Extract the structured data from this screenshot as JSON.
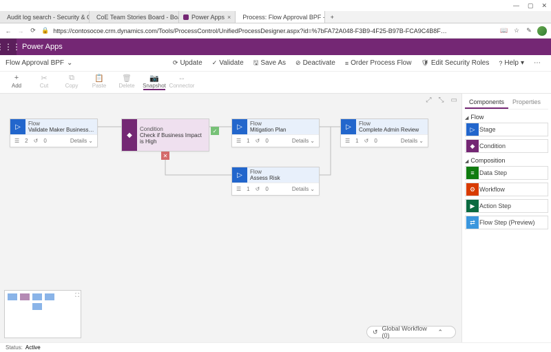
{
  "browser": {
    "win_controls": {
      "min": "—",
      "max": "▢",
      "close": "✕"
    },
    "tabs": [
      {
        "fav": "#4aa0e6",
        "label": "Audit log search - Security & C",
        "active": false
      },
      {
        "fav": "#2b6cb0",
        "label": "CoE Team Stories Board - Boards",
        "active": false
      },
      {
        "fav": "#742774",
        "label": "Power Apps",
        "active": false
      },
      {
        "fav": "#742774",
        "label": "Process: Flow Approval BPF - M",
        "active": true
      }
    ],
    "new_tab": "+",
    "nav": {
      "back": "←",
      "fwd": "→",
      "refresh": "⟳"
    },
    "lock": "🔒",
    "url": "https://contosocoe.crm.dynamics.com/Tools/ProcessControl/UnifiedProcessDesigner.aspx?id=%7bFA72A048-F3B9-4F25-B97B-FCA9C4B8F…",
    "right_icons": {
      "reader": "📖",
      "star": "☆",
      "notes": "✎"
    }
  },
  "suite": {
    "title": "Power Apps",
    "waffle": "⋮⋮⋮"
  },
  "cmdbar": {
    "title": "Flow Approval BPF",
    "chev": "⌄",
    "actions": [
      {
        "ic": "⟳",
        "label": "Update"
      },
      {
        "ic": "✓",
        "label": "Validate"
      },
      {
        "ic": "🖫",
        "label": "Save As"
      },
      {
        "ic": "⊘",
        "label": "Deactivate"
      },
      {
        "ic": "≡",
        "label": "Order Process Flow"
      },
      {
        "ic": "🛡",
        "label": "Edit Security Roles"
      },
      {
        "ic": "?",
        "label": "Help",
        "chev": "▾"
      }
    ],
    "more": "⋯"
  },
  "toolbar": [
    {
      "ic": "+",
      "label": "Add",
      "disabled": false
    },
    {
      "ic": "✂",
      "label": "Cut",
      "disabled": true
    },
    {
      "ic": "⧉",
      "label": "Copy",
      "disabled": true
    },
    {
      "ic": "📋",
      "label": "Paste",
      "disabled": true
    },
    {
      "ic": "🗑",
      "label": "Delete",
      "disabled": true
    },
    {
      "ic": "📷",
      "label": "Snapshot",
      "active": true
    },
    {
      "ic": "↔",
      "label": "Connector",
      "disabled": true
    }
  ],
  "zoom": {
    "out": "⤢",
    "in": "⤡",
    "fit": "▭"
  },
  "stages": {
    "s1": {
      "type": "Flow",
      "title": "Validate Maker Business Require...",
      "steps": "2",
      "cnt": "0",
      "details": "Details"
    },
    "s2": {
      "type": "Condition",
      "title": "Check if Business Impact is High"
    },
    "s3": {
      "type": "Flow",
      "title": "Mitigation Plan",
      "steps": "1",
      "cnt": "0",
      "details": "Details"
    },
    "s4": {
      "type": "Flow",
      "title": "Complete Admin Review",
      "steps": "1",
      "cnt": "0",
      "details": "Details"
    },
    "s5": {
      "type": "Flow",
      "title": "Assess Risk",
      "steps": "1",
      "cnt": "0",
      "details": "Details"
    },
    "foot": {
      "step_ic": "☰",
      "cnt_ic": "↺",
      "chev": "⌄"
    }
  },
  "cond": {
    "yes": "✓",
    "no": "✕"
  },
  "minimap": {
    "expand": "⛶"
  },
  "global_workflow": {
    "ic": "↺",
    "label": "Global Workflow (0)",
    "chev": "⌃"
  },
  "sidepanel": {
    "tabs": {
      "components": "Components",
      "properties": "Properties"
    },
    "sections": {
      "flow": "Flow",
      "composition": "Composition"
    },
    "flow_items": [
      {
        "cls": "c-blue",
        "ic": "▷",
        "label": "Stage"
      },
      {
        "cls": "c-purple",
        "ic": "◆",
        "label": "Condition"
      }
    ],
    "comp_items": [
      {
        "cls": "c-green",
        "ic": "≡",
        "label": "Data Step"
      },
      {
        "cls": "c-orange",
        "ic": "⚙",
        "label": "Workflow"
      },
      {
        "cls": "c-dgreen",
        "ic": "▶",
        "label": "Action Step"
      },
      {
        "cls": "c-lblue",
        "ic": "⇄",
        "label": "Flow Step (Preview)"
      }
    ]
  },
  "status": {
    "label": "Status:",
    "value": "Active"
  }
}
